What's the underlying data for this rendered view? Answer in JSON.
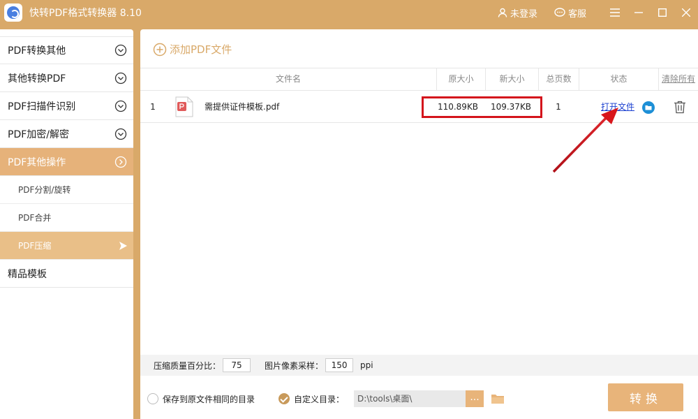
{
  "app": {
    "title": "快转PDF格式转换器 8.10",
    "login_label": "未登录",
    "service_label": "客服"
  },
  "sidebar": {
    "items": [
      {
        "label": "PDF转换其他"
      },
      {
        "label": "其他转换PDF"
      },
      {
        "label": "PDF扫描件识别"
      },
      {
        "label": "PDF加密/解密"
      },
      {
        "label": "PDF其他操作"
      }
    ],
    "subitems": [
      {
        "label": "PDF分割/旋转"
      },
      {
        "label": "PDF合并"
      },
      {
        "label": "PDF压缩"
      }
    ],
    "bottom_item": {
      "label": "精品模板"
    }
  },
  "main": {
    "add_file_label": "添加PDF文件",
    "columns": {
      "name": "文件名",
      "orig_size": "原大小",
      "new_size": "新大小",
      "pages": "总页数",
      "status": "状态",
      "clear": "清除所有"
    },
    "rows": [
      {
        "index": "1",
        "file_name": "需提供证件模板.pdf",
        "orig_size": "110.89KB",
        "new_size": "109.37KB",
        "pages": "1",
        "status_link": "打开文件"
      }
    ],
    "quality_label": "压缩质量百分比：",
    "quality_value": "75",
    "sampling_label": "图片像素采样：",
    "sampling_value": "150",
    "sampling_unit": "ppi",
    "save_same_label": "保存到原文件相同的目录",
    "custom_dir_label": "自定义目录：",
    "custom_dir_value": "D:\\tools\\桌面\\",
    "dots_label": "...",
    "convert_label": "转换"
  },
  "colors": {
    "accent": "#d9a969",
    "highlight": "#d4141c",
    "link": "#1a3fd0"
  }
}
